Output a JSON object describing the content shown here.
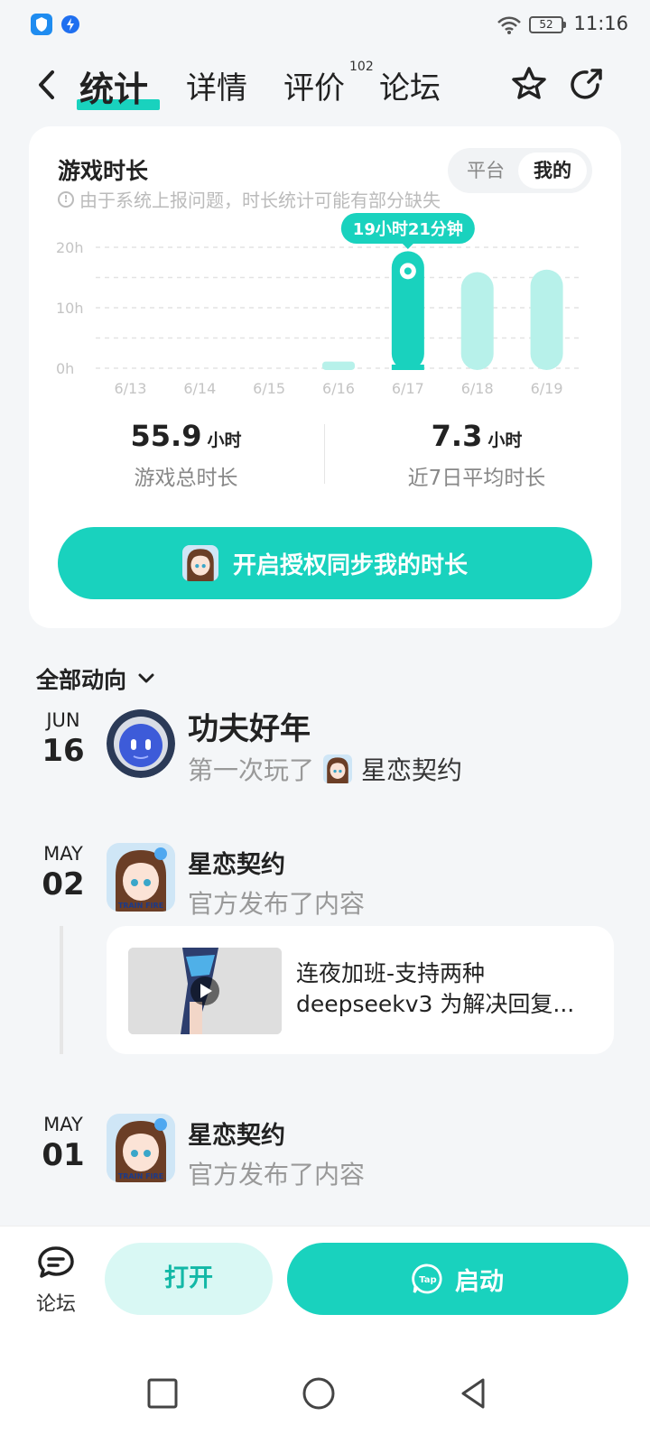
{
  "status_bar": {
    "time": "11:16",
    "battery": "52"
  },
  "nav": {
    "tabs": [
      {
        "label": "统计",
        "active": true
      },
      {
        "label": "详情"
      },
      {
        "label": "评价",
        "badge": "102"
      },
      {
        "label": "论坛"
      }
    ]
  },
  "stats": {
    "title": "游戏时长",
    "note": "由于系统上报问题，时长统计可能有部分缺失",
    "toggle": {
      "options": [
        "平台",
        "我的"
      ],
      "selected": "我的"
    },
    "total": {
      "value": "55.9",
      "unit": "小时",
      "label": "游戏总时长"
    },
    "average": {
      "value": "7.3",
      "unit": "小时",
      "label": "近7日平均时长"
    },
    "sync_button": "开启授权同步我的时长"
  },
  "chart_data": {
    "type": "bar",
    "categories": [
      "6/13",
      "6/14",
      "6/15",
      "6/16",
      "6/17",
      "6/18",
      "6/19"
    ],
    "values": [
      0,
      0,
      0,
      1.1,
      19.35,
      15.9,
      16.3
    ],
    "ylim": [
      0,
      20
    ],
    "yticks": [
      "0h",
      "10h",
      "20h"
    ],
    "highlighted_index": 4,
    "tooltip": "19小时21分钟",
    "colors": {
      "highlight": "#19d2be",
      "normal": "#b7f1ea"
    }
  },
  "feed": {
    "filter_label": "全部动向",
    "items": [
      {
        "month": "JUN",
        "day": "16",
        "name": "功夫好年",
        "action": "第一次玩了",
        "game": "星恋契约"
      },
      {
        "month": "MAY",
        "day": "02",
        "name": "星恋契约",
        "action": "官方发布了内容",
        "post": {
          "line1": "连夜加班-支持两种",
          "line2": "deepseekv3 为解决回复..."
        }
      },
      {
        "month": "MAY",
        "day": "01",
        "name": "星恋契约",
        "action": "官方发布了内容"
      }
    ],
    "avatar_caption": "TRAIN FIRE"
  },
  "bottom_bar": {
    "forum_label": "论坛",
    "open_label": "打开",
    "launch_label": "启动",
    "tap_logo": "Tap"
  },
  "colors": {
    "accent": "#19d2be",
    "accent_light": "#d9f8f4",
    "background": "#f4f6f8"
  }
}
